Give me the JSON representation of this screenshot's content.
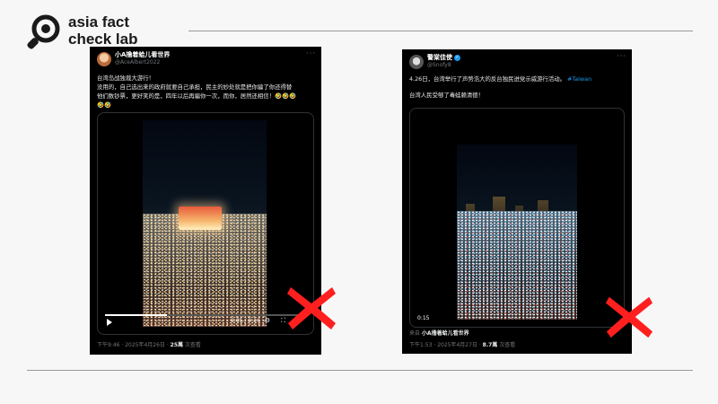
{
  "brand": {
    "line1": "asia fact",
    "line2": "check lab"
  },
  "colors": {
    "accent": "#ff1f1f",
    "x_blue": "#1d9bf0",
    "tweet_bg": "#000000",
    "rule": "#9a9a9a"
  },
  "verdict_icon": "red-x-mark",
  "tweets": [
    {
      "display_name": "小A撸着蛤儿看世界",
      "handle": "@AceAlbert2022",
      "more": "···",
      "lines": [
        "台湾岛战独裁大游行！",
        "没用的，自己选出来的政府就要自己承担，民主的妙处就是把你骗了你还得替",
        "他们数钞票，更好笑的是，四年以后再骗你一次，而你，居然还相信！🤣🤣🤣",
        "🤣🤣"
      ],
      "video": {
        "elapsed": "0:05",
        "duration": "0:16",
        "progress": 0.31,
        "controls": "⚙ ⛶ ⤢"
      },
      "meta": {
        "time": "下午9:46 · 2025年4月26日 · ",
        "views": "25萬",
        "views_label": " 次查看"
      }
    },
    {
      "display_name": "警棠佳使",
      "handle": "@Snofy8",
      "more": "···",
      "verified_icon": "✓",
      "lines_line1_text": "4.26日，台湾举行了声势浩大的反台独民进党示威游行活动。",
      "lines_line1_hashtag": "#Taiwan",
      "line2": "台湾人民受够了毒蛙赖清德！",
      "video": {
        "time_badge": "0:15"
      },
      "source": {
        "label": "来自 ",
        "author": "小A撸着蛤儿看世界"
      },
      "meta": {
        "time": "下午1:53 · 2025年4月27日 · ",
        "views": "8.7萬",
        "views_label": " 次查看"
      }
    }
  ]
}
